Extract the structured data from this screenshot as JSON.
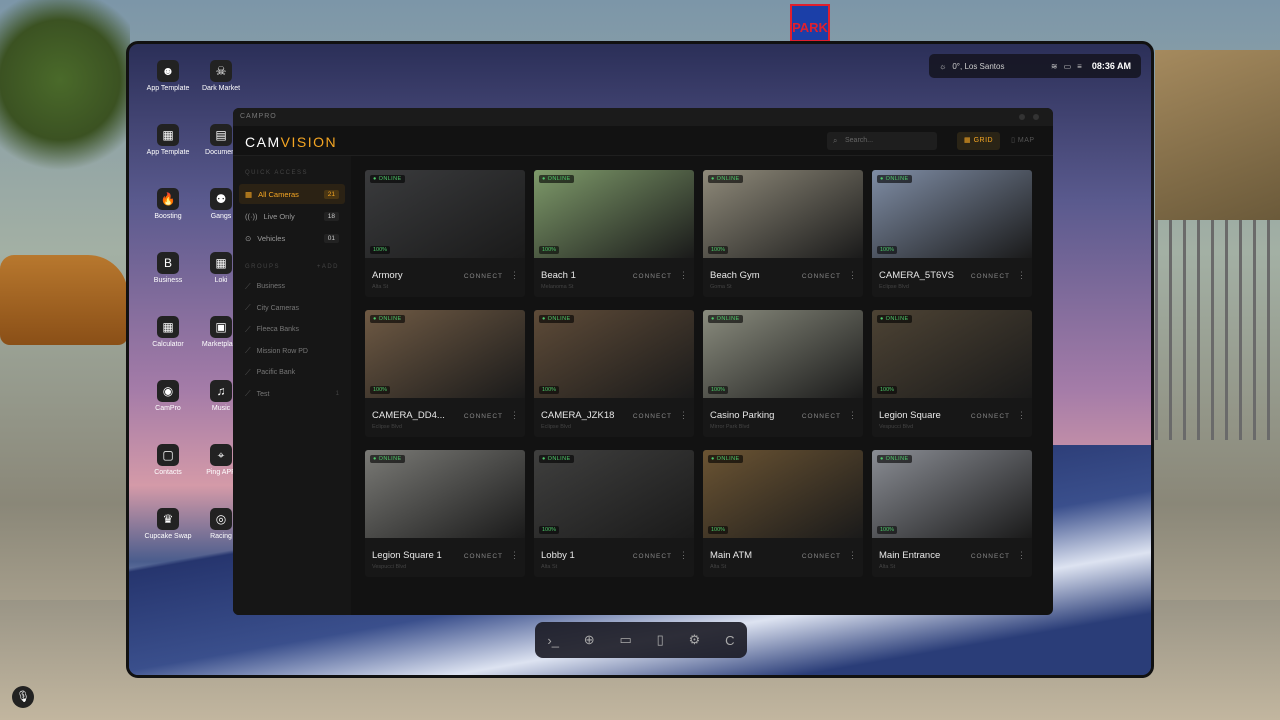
{
  "phone_status": {
    "location": "0°, Los Santos",
    "time": "08:36 AM"
  },
  "desktop_apps": [
    {
      "label": "App Template",
      "glyph": "☻"
    },
    {
      "label": "Dark Market",
      "glyph": "☠"
    },
    {
      "label": "App Template",
      "glyph": "▦"
    },
    {
      "label": "Document",
      "glyph": "▤"
    },
    {
      "label": "Boosting",
      "glyph": "🔥"
    },
    {
      "label": "Gangs",
      "glyph": "⚉"
    },
    {
      "label": "Business",
      "glyph": "B"
    },
    {
      "label": "Loki",
      "glyph": "▦"
    },
    {
      "label": "Calculator",
      "glyph": "▦"
    },
    {
      "label": "Marketplace",
      "glyph": "▣"
    },
    {
      "label": "CamPro",
      "glyph": "◉"
    },
    {
      "label": "Music",
      "glyph": "♫"
    },
    {
      "label": "Contacts",
      "glyph": "▢"
    },
    {
      "label": "Ping APP",
      "glyph": "⌖"
    },
    {
      "label": "Cupcake Swap",
      "glyph": "♛"
    },
    {
      "label": "Racing",
      "glyph": "◎"
    }
  ],
  "window": {
    "title": "CAMPRO",
    "brand_a": "CAM",
    "brand_b": "VISION"
  },
  "search": {
    "placeholder": "Search..."
  },
  "view": {
    "grid": "GRID",
    "map": "MAP"
  },
  "sidebar": {
    "quick_title": "QUICK ACCESS",
    "quick": [
      {
        "label": "All Cameras",
        "count": "21",
        "glyph": "▦"
      },
      {
        "label": "Live Only",
        "count": "18",
        "glyph": "((·))"
      },
      {
        "label": "Vehicles",
        "count": "01",
        "glyph": "⊙"
      }
    ],
    "groups_title": "GROUPS",
    "groups_action": "+ADD",
    "groups": [
      {
        "label": "Business",
        "count": ""
      },
      {
        "label": "City Cameras",
        "count": ""
      },
      {
        "label": "Fleeca Banks",
        "count": ""
      },
      {
        "label": "Mission Row PD",
        "count": ""
      },
      {
        "label": "Pacific Bank",
        "count": ""
      },
      {
        "label": "Test",
        "count": "1"
      }
    ]
  },
  "camera_labels": {
    "online": "● ONLINE",
    "connect": "CONNECT"
  },
  "cameras": [
    {
      "name": "Armory",
      "location": "Alta St",
      "signal": "100%",
      "color": "#3a3b3d"
    },
    {
      "name": "Beach 1",
      "location": "Melanoma St",
      "signal": "100%",
      "color": "#7e9a6a"
    },
    {
      "name": "Beach Gym",
      "location": "Goma St",
      "signal": "100%",
      "color": "#8f8a7a"
    },
    {
      "name": "CAMERA_5T6VS",
      "location": "Eclipse Blvd",
      "signal": "100%",
      "color": "#7f8da5"
    },
    {
      "name": "CAMERA_DD4...",
      "location": "Eclipse Blvd",
      "signal": "100%",
      "color": "#6f5a44"
    },
    {
      "name": "CAMERA_JZK18",
      "location": "Eclipse Blvd",
      "signal": "100%",
      "color": "#5e4b38"
    },
    {
      "name": "Casino Parking",
      "location": "Mirror Park Blvd",
      "signal": "100%",
      "color": "#8a8c7e"
    },
    {
      "name": "Legion Square",
      "location": "Vespucci Blvd",
      "signal": "100%",
      "color": "#4d4334"
    },
    {
      "name": "Legion Square 1",
      "location": "Vespucci Blvd",
      "signal": "",
      "color": "#7a7a76"
    },
    {
      "name": "Lobby 1",
      "location": "Alta St",
      "signal": "100%",
      "color": "#3f3f3e"
    },
    {
      "name": "Main ATM",
      "location": "Alta St",
      "signal": "100%",
      "color": "#6b5433"
    },
    {
      "name": "Main Entrance",
      "location": "Alta St",
      "signal": "100%",
      "color": "#8a8d94"
    }
  ],
  "partial_row_colors": [
    "#6e7a8a",
    "#5a4a33",
    "#584631",
    "#3a3030"
  ],
  "dock": [
    "›_",
    "⊕",
    "▭",
    "▯",
    "⚙",
    "C"
  ]
}
